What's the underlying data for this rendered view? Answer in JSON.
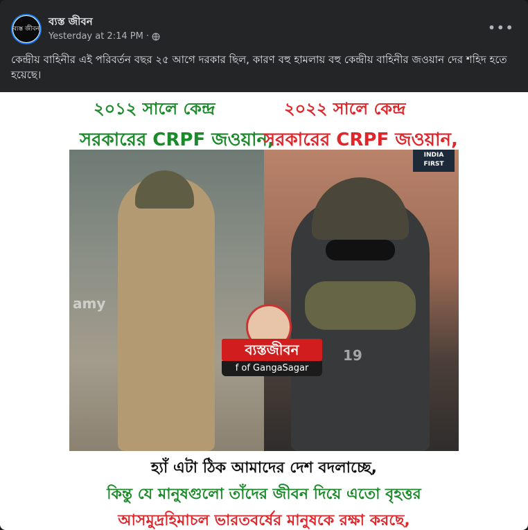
{
  "post": {
    "page_name": "ব্যস্ত জীবন",
    "avatar_text": "ব্যস্ত জীবন",
    "timestamp": "Yesterday at 2:14 PM",
    "separator": "·",
    "more_icon_label": "•••",
    "text": "কেন্দ্রীয় বাহিনীর এই পরিবর্তন বছর ২৫ আগে দরকার ছিল, কারণ বহু হামলায় বহু কেন্দ্রীয় বাহিনীর জওয়ান দের শহিদ হতে হয়েছে।"
  },
  "image": {
    "heading_left_line1": "২০১২ সালে কেন্দ্র",
    "heading_right_line1": "২০২২ সালে কেন্দ্র",
    "heading_left_line2": "সরকারের CRPF জওয়ান,",
    "heading_right_line2": "সরকারের CRPF জওয়ান,",
    "tv_logo": "INDIA FIRST",
    "badge_name": "ব্যস্তজীবন",
    "badge_sub": "f of GangaSagar",
    "watermark_left": "amy",
    "watermark_right": "19",
    "bottom_line1": "হ্যাঁ এটা ঠিক আমাদের দেশ বদলাচ্ছে,",
    "bottom_line2": "কিন্তু যে মানুষগুলো তাঁদের জীবন দিয়ে এতো বৃহত্তর",
    "bottom_line3": "আসমুদ্রহিমাচল ভারতবর্ষের মানুষকে রক্ষা করছে,"
  },
  "colors": {
    "green": "#1b8a2a",
    "red": "#e0262b",
    "card_bg": "#242526"
  }
}
